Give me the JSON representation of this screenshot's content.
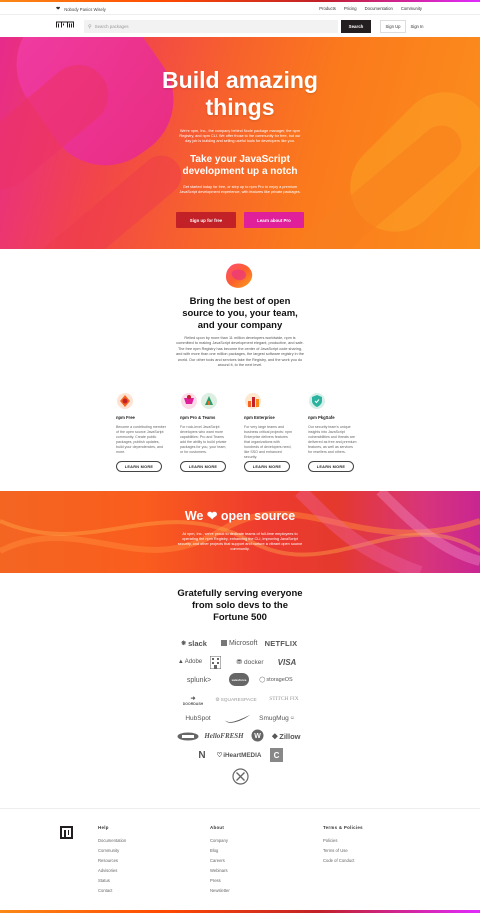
{
  "utility": {
    "tagline": "Nobody Panics Wisely",
    "links": [
      "Products",
      "Pricing",
      "Documentation",
      "Community"
    ]
  },
  "nav": {
    "search_placeholder": "Search packages",
    "search_button": "Search",
    "signup": "Sign Up",
    "signin": "Sign In"
  },
  "hero": {
    "title_line1": "Build amazing",
    "title_line2": "things",
    "intro": "We're npm, Inc., the company behind Node package manager, the npm Registry, and npm CLI. We offer those to the community for free, but our day job is building and selling useful tools for developers like you.",
    "subtitle_line1": "Take your JavaScript",
    "subtitle_line2": "development up a notch",
    "sub_intro": "Get started today for free, or step up to npm Pro to enjoy a premium JavaScript development experience, with features like private packages.",
    "cta_free": "Sign up for free",
    "cta_pro": "Learn about Pro"
  },
  "open_source": {
    "title_line1": "Bring the best of open",
    "title_line2": "source to you, your team,",
    "title_line3": "and your company",
    "body": "Relied upon by more than 11 million developers worldwide, npm is committed to making JavaScript development elegant, productive, and safe. The free npm Registry has become the center of JavaScript code sharing, and with more than one million packages, the largest software registry in the world. Our other tools and services take the Registry, and the work you do around it, to the next level."
  },
  "products": [
    {
      "title": "npm Free",
      "desc": "Become a contributing member of the open source JavaScript community. Create public packages, publish updates, build your dependencies, and more.",
      "button": "LEARN MORE"
    },
    {
      "title": "npm Pro & Teams",
      "desc": "For rock-level JavaScript developers who want more capabilities: Pro and Teams add the ability to build private packages for you, your team, or for customers.",
      "button": "LEARN MORE"
    },
    {
      "title": "npm Enterprise",
      "desc": "For very large teams and business critical projects: npm Enterprise delivers features that organizations with hundreds of developers need, like SSO and enhanced security.",
      "button": "LEARN MORE"
    },
    {
      "title": "npm PkgSafe",
      "desc": "Our security team's unique insights into JavaScript vulnerabilities and threats are delivered as free and premium features, as well as services for resellers and others.",
      "button": "LEARN MORE"
    }
  ],
  "banner": {
    "title_pre": "We",
    "title_post": "open source",
    "text": "At npm, Inc., we're proud to dedicate teams of full-time employees to operating the npm Registry, enhancing the CLI, improving JavaScript security, and other projects that support and nurture a vibrant open source community."
  },
  "customers": {
    "title_line1": "Gratefully serving everyone",
    "title_line2": "from solo devs to the",
    "title_line3": "Fortune 500",
    "logos": [
      "slack",
      "Microsoft",
      "NETFLIX",
      "Adobe",
      "docker",
      "VISA",
      "splunk>",
      "salesforce",
      "storageOS",
      "DOORDASH",
      "SQUARESPACE",
      "STITCH FIX",
      "HubSpot",
      "SmugMug",
      "HelloFRESH",
      "Zillow",
      "iHeartMEDIA"
    ]
  },
  "footer": {
    "help": {
      "heading": "Help",
      "items": [
        "Documentation",
        "Community",
        "Resources",
        "Advisories",
        "Status",
        "Contact"
      ]
    },
    "about": {
      "heading": "About",
      "items": [
        "Company",
        "Blog",
        "Careers",
        "Webinars",
        "Press",
        "Newsletter"
      ]
    },
    "terms": {
      "heading": "Terms & Policies",
      "items": [
        "Policies",
        "Terms of Use",
        "Code of Conduct"
      ]
    }
  },
  "colors": {
    "npm_red": "#c12127",
    "pro_pink": "#e0209b",
    "dark": "#231f20"
  }
}
